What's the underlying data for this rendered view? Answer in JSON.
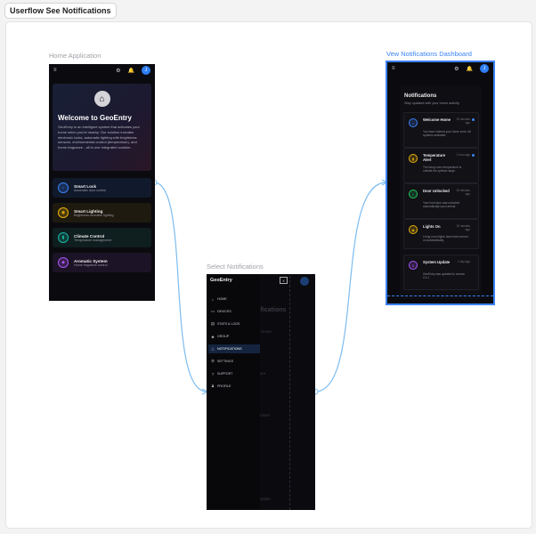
{
  "page": {
    "title": "Userflow See Notifications"
  },
  "frames": {
    "home": {
      "label": "Home Application",
      "avatar": "J",
      "hero_title": "Welcome to GeoEntry",
      "hero_text": "GeoEntry is an intelligent system that activates your home when you're nearby. Our solution includes electronic locks, automatic lighting with brightness sensors, environmental control (temperature), and home fragrance - all in one integrated solution.",
      "cards": [
        {
          "title": "Smart Lock",
          "subtitle": "Automatic door control",
          "icon": "lock-icon",
          "color": "#3b82f6",
          "bg": "#111a2c"
        },
        {
          "title": "Smart Lighting",
          "subtitle": "Brightness-sensitive lighting",
          "icon": "bulb-icon",
          "color": "#eab308",
          "bg": "#1f1a0f"
        },
        {
          "title": "Climate Control",
          "subtitle": "Temperature management",
          "icon": "thermometer-icon",
          "color": "#14b8a6",
          "bg": "#0f1e1f"
        },
        {
          "title": "Aromatic System",
          "subtitle": "Home fragrance control",
          "icon": "drop-icon",
          "color": "#a855f7",
          "bg": "#1d1326"
        }
      ]
    },
    "select": {
      "label": "Select Notifications",
      "brand": "GeoEntry",
      "ghost_title": "Notifications",
      "menu": [
        {
          "label": "HOME",
          "icon": "home-icon",
          "active": false
        },
        {
          "label": "DEVICES",
          "icon": "devices-icon",
          "active": false
        },
        {
          "label": "STATS & LOGS",
          "icon": "stats-icon",
          "active": false
        },
        {
          "label": "GROUP",
          "icon": "group-icon",
          "active": false
        },
        {
          "label": "NOTIFICATIONS",
          "icon": "bell-icon",
          "active": true
        },
        {
          "label": "SETTINGS",
          "icon": "gear-icon",
          "active": false
        },
        {
          "label": "SUPPORT",
          "icon": "support-icon",
          "active": false
        },
        {
          "label": "PROFILE",
          "icon": "profile-icon",
          "active": false
        }
      ],
      "ghost_items": [
        "Welcome Home",
        "Temperature Alert",
        "Door Unlocked",
        "Lights On",
        "System Update"
      ]
    },
    "dashboard": {
      "label": "Vew Notifications Dashboard",
      "avatar": "J",
      "title": "Notifications",
      "subtitle": "Stay updated with your home activity",
      "items": [
        {
          "title": "Welcome Home",
          "time": "15 minutes ago",
          "body": "You have entered your home zone. All systems activated.",
          "icon": "home-icon",
          "color": "#3b82f6",
          "unread": true
        },
        {
          "title": "Temperature Alert",
          "time": "1 hour ago",
          "body": "The living room temperature is outside the optimal range.",
          "icon": "thermometer-icon",
          "color": "#eab308",
          "unread": true
        },
        {
          "title": "Door Unlocked",
          "time": "15 minutes ago",
          "body": "Your front door was unlocked automatically upon arrival.",
          "icon": "lock-icon",
          "color": "#22c55e",
          "unread": false
        },
        {
          "title": "Lights On",
          "time": "15 minutes ago",
          "body": "Living room lights have been turned on automatically.",
          "icon": "bulb-icon",
          "color": "#eab308",
          "unread": false
        },
        {
          "title": "System Update",
          "time": "1 day ago",
          "body": "GeoEntry was updated to version 2.4.1",
          "icon": "info-icon",
          "color": "#a855f7",
          "unread": false
        }
      ]
    }
  }
}
